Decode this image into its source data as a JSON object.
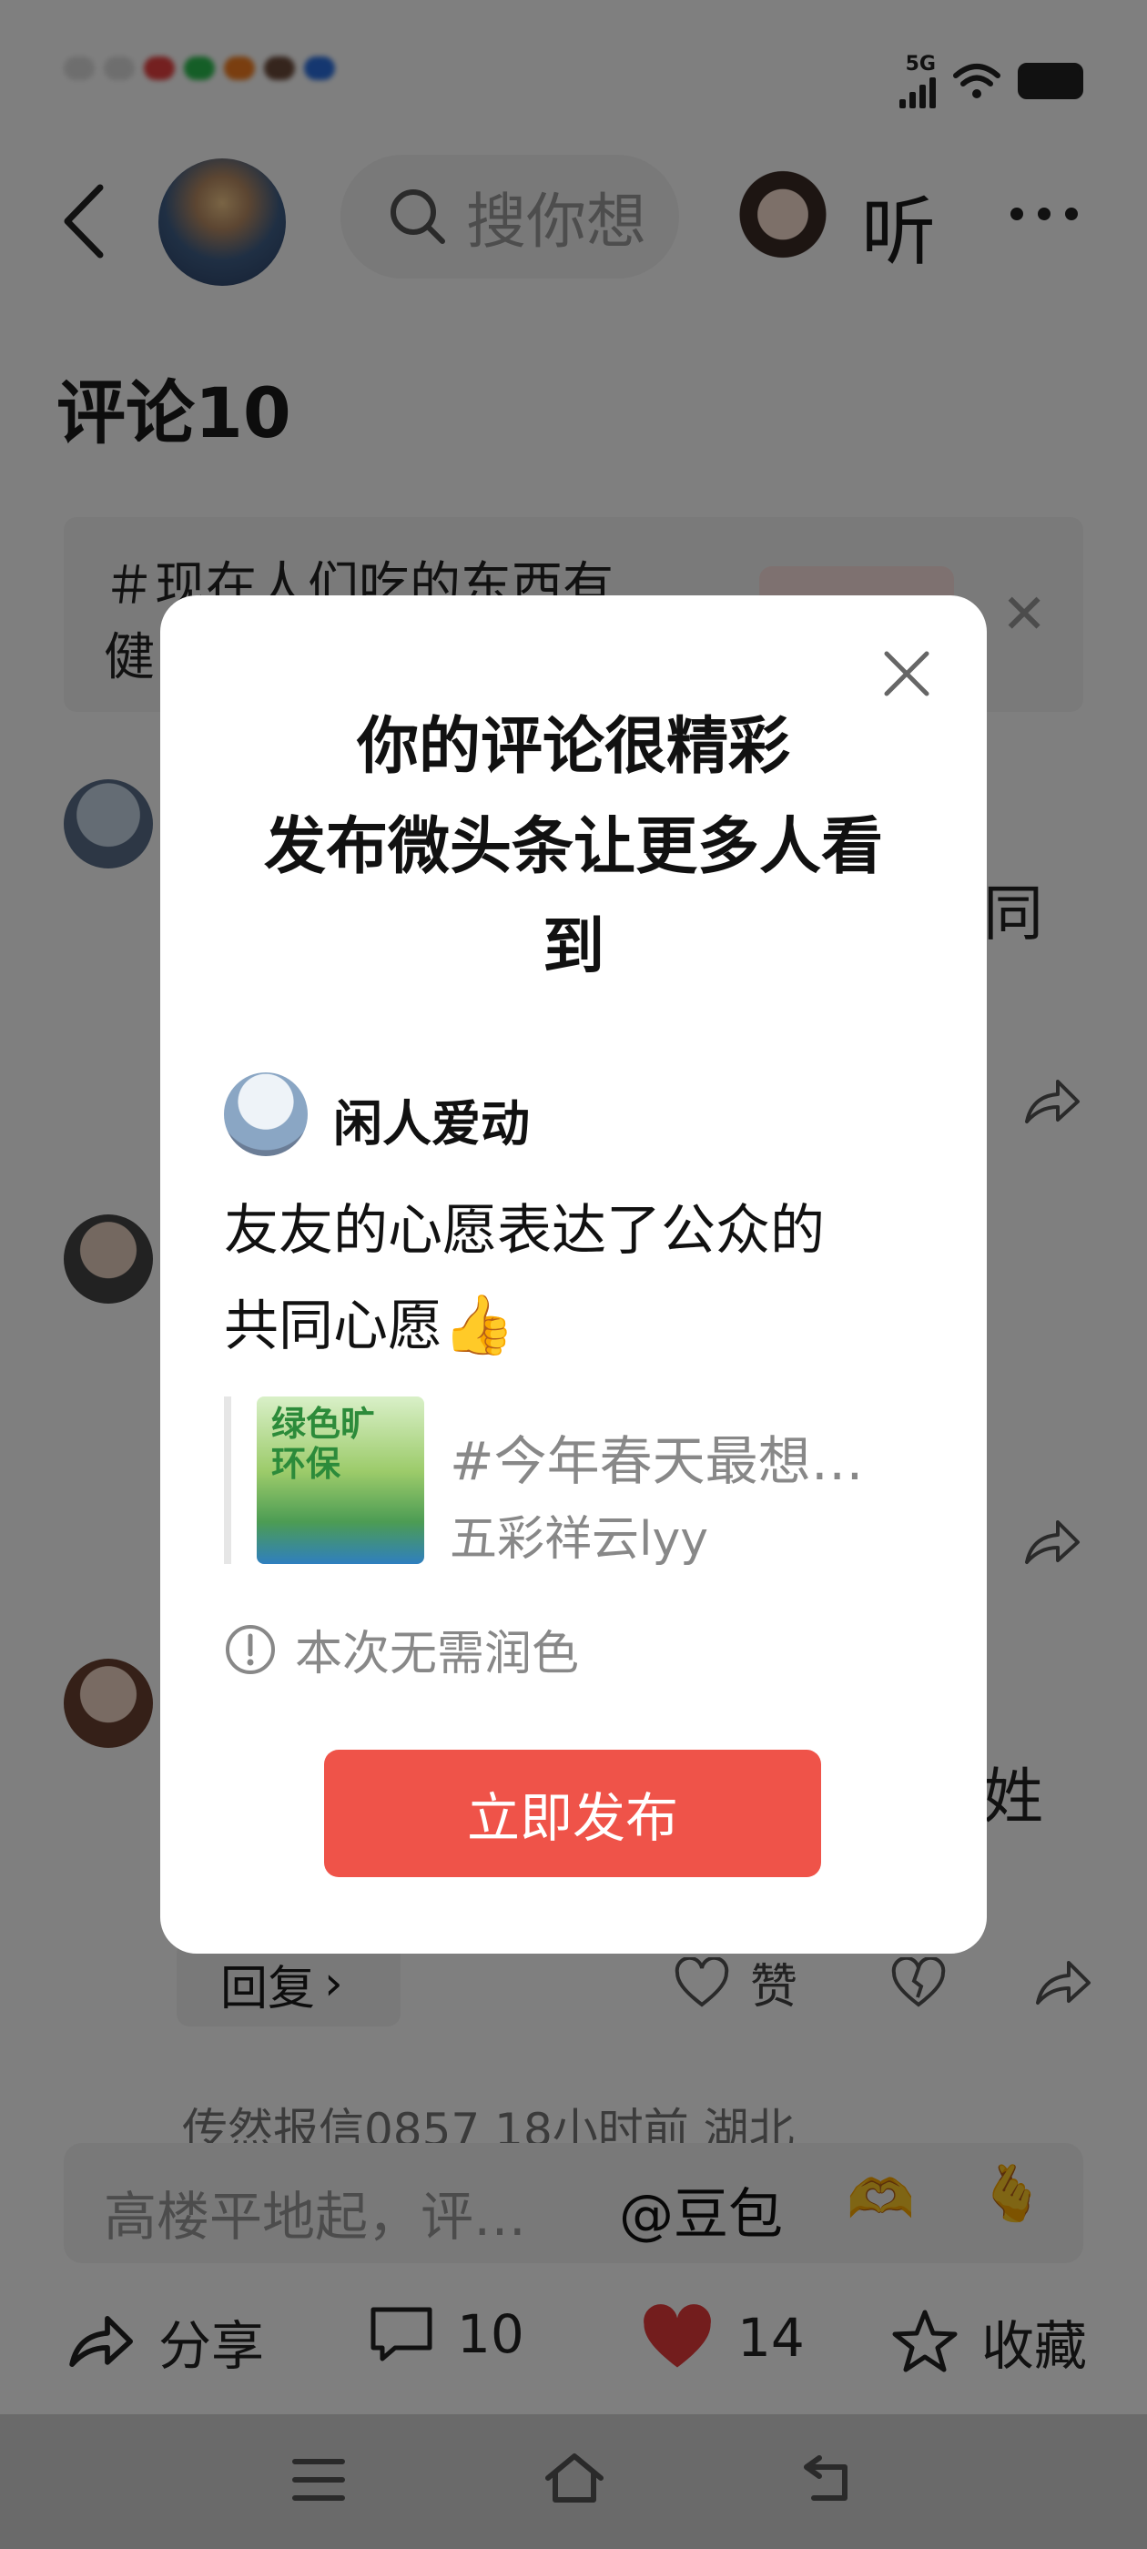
{
  "status_bar": {
    "network": "5G"
  },
  "header": {
    "search_placeholder": "搜你想",
    "listen_label": "听"
  },
  "comments": {
    "title": "评论10",
    "topic_line1": "现在人们吃的东西有",
    "topic_line2": "健",
    "frag_1": "同",
    "frag_2": "姓",
    "reply_label": "回复",
    "like_label": "赞",
    "faded_user": "传然报信0857 18小时前 湖北"
  },
  "input": {
    "placeholder": "高楼平地起，评…",
    "mention": "@豆包",
    "emoji_1": "🫶",
    "emoji_2": "🫰"
  },
  "bottom_bar": {
    "share_label": "分享",
    "comment_count": "10",
    "like_count": "14",
    "collect_label": "收藏"
  },
  "modal": {
    "title_line1": "你的评论很精彩",
    "title_line2": "发布微头条让更多人看",
    "title_line3": "到",
    "user_name": "闲人爱动",
    "post_line1": "友友的心愿表达了公众的",
    "post_line2": "共同心愿",
    "post_emoji": "👍",
    "quote_image_text_1": "绿色旷",
    "quote_image_text_2": "环保",
    "quote_title": "#今年春天最想…",
    "quote_author": "五彩祥云lyy",
    "notice": "本次无需润色",
    "publish_label": "立即发布"
  },
  "colors": {
    "primary_red": "#ef5349",
    "overlay": "rgba(0,0,0,0.5)",
    "nav_bar": "#6a6a6a"
  }
}
